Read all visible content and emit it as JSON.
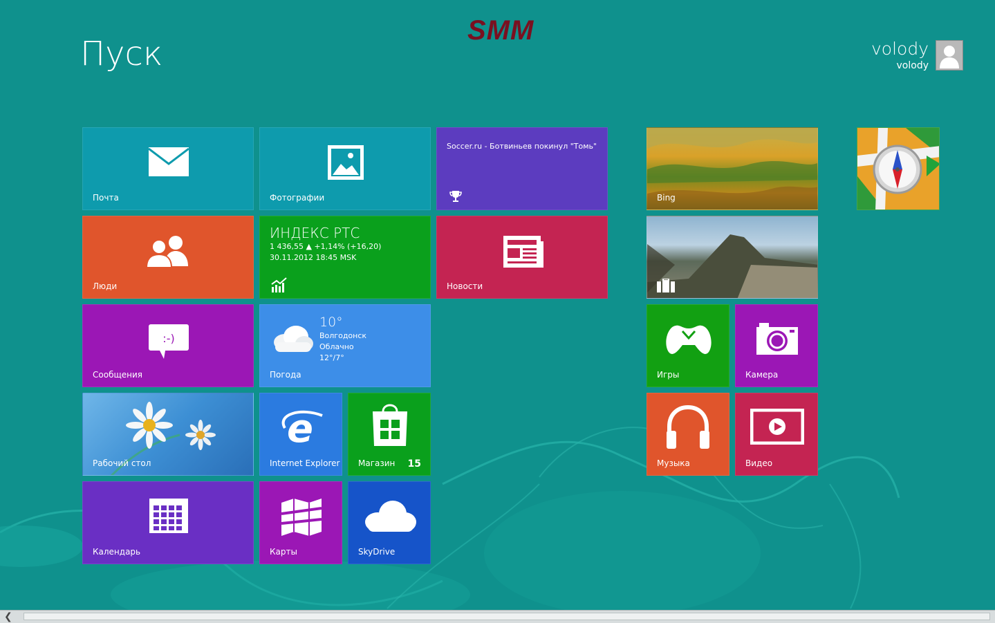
{
  "start": {
    "title": "Пуск"
  },
  "logo": {
    "text": "SMM"
  },
  "user": {
    "name": "volody",
    "account": "volody"
  },
  "tiles": {
    "mail": {
      "label": "Почта",
      "color": "#0e9bad"
    },
    "photos": {
      "label": "Фотографии",
      "color": "#0e9bad"
    },
    "sport": {
      "label": "Soccer.ru - Ботвиньев покинул \"Томь\"",
      "color": "#5c3cbf"
    },
    "people": {
      "label": "Люди",
      "color": "#e0552c"
    },
    "finance": {
      "title": "ИНДЕКС РТС",
      "line1": "1 436,55  ▲ +1,14% (+16,20)",
      "line2": "30.11.2012 18:45 MSK",
      "color": "#0aa01c"
    },
    "news": {
      "label": "Новости",
      "color": "#c42452"
    },
    "messaging": {
      "label": "Сообщения",
      "color": "#9b17b5"
    },
    "weather": {
      "label": "Погода",
      "temp": "10°",
      "city": "Волгодонск",
      "condition": "Облачно",
      "range": "12°/7°",
      "color": "#3d8ee8"
    },
    "desktop": {
      "label": "Рабочий стол"
    },
    "ie": {
      "label": "Internet Explorer",
      "color": "#2b7be0"
    },
    "store": {
      "label": "Магазин",
      "badge": "15",
      "color": "#0aa01c"
    },
    "calendar": {
      "label": "Календарь",
      "color": "#6a2fc4"
    },
    "maps": {
      "label": "Карты",
      "color": "#9b17b5"
    },
    "skydrive": {
      "label": "SkyDrive",
      "color": "#1654c9"
    },
    "bing": {
      "label": "Bing"
    },
    "travel": {
      "label": ""
    },
    "games": {
      "label": "Игры",
      "color": "#12a012"
    },
    "camera": {
      "label": "Камера",
      "color": "#9b17b5"
    },
    "music": {
      "label": "Музыка",
      "color": "#e0552c"
    },
    "video": {
      "label": "Видео",
      "color": "#c42452"
    },
    "navigator": {
      "label": ""
    }
  }
}
